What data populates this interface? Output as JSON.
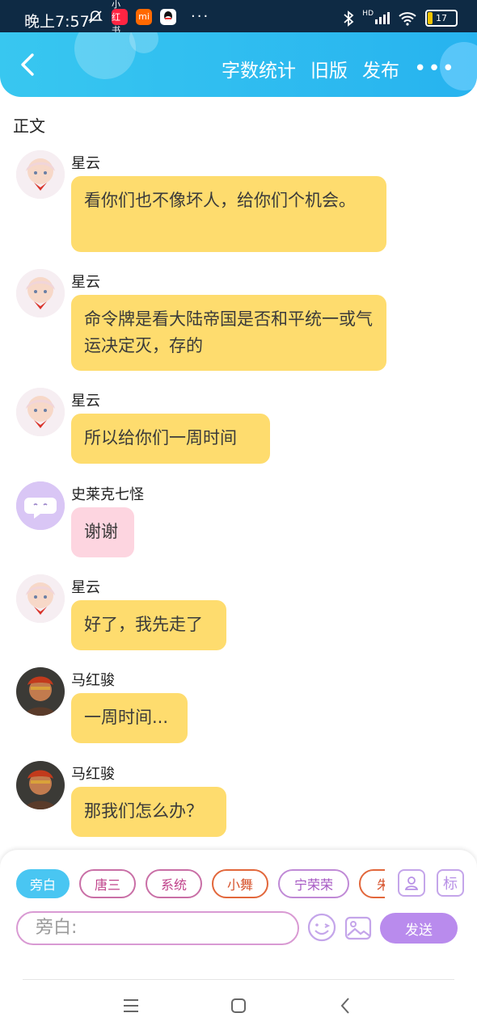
{
  "status_bar": {
    "time": "晚上7:57",
    "app_badges": [
      "小红书",
      "mi",
      "QQ"
    ],
    "more": "···",
    "signal": "HD",
    "battery": "17"
  },
  "navbar": {
    "word_count": "字数统计",
    "old_version": "旧版",
    "publish": "发布",
    "more": "•••"
  },
  "section_label": "正文",
  "messages": [
    {
      "name": "星云",
      "text": "看你们也不像坏人，给你们个机会。",
      "style": "yellow"
    },
    {
      "name": "星云",
      "text": "命令牌是看大陆帝国是否和平统一或气运决定灭，存的",
      "style": "yellow"
    },
    {
      "name": "星云",
      "text": "所以给你们一周时间",
      "style": "yellow"
    },
    {
      "name": "史莱克七怪",
      "text": "谢谢",
      "style": "pink"
    },
    {
      "name": "星云",
      "text": "好了，我先走了",
      "style": "yellow"
    },
    {
      "name": "马红骏",
      "text": "一周时间...",
      "style": "yellow"
    },
    {
      "name": "马红骏",
      "text": "那我们怎么办？",
      "style": "yellow"
    }
  ],
  "composer": {
    "roles": [
      "旁白",
      "唐三",
      "系统",
      "小舞",
      "宁荣荣",
      "朱"
    ],
    "input_placeholder": "旁白:",
    "send_label": "发送",
    "tag_label": "标"
  },
  "colors": {
    "nav_blue": "#2fbdf0",
    "bubble_yellow": "#fedc6e",
    "bubble_pink": "#fdd5e0",
    "send_purple": "#b98bed"
  }
}
